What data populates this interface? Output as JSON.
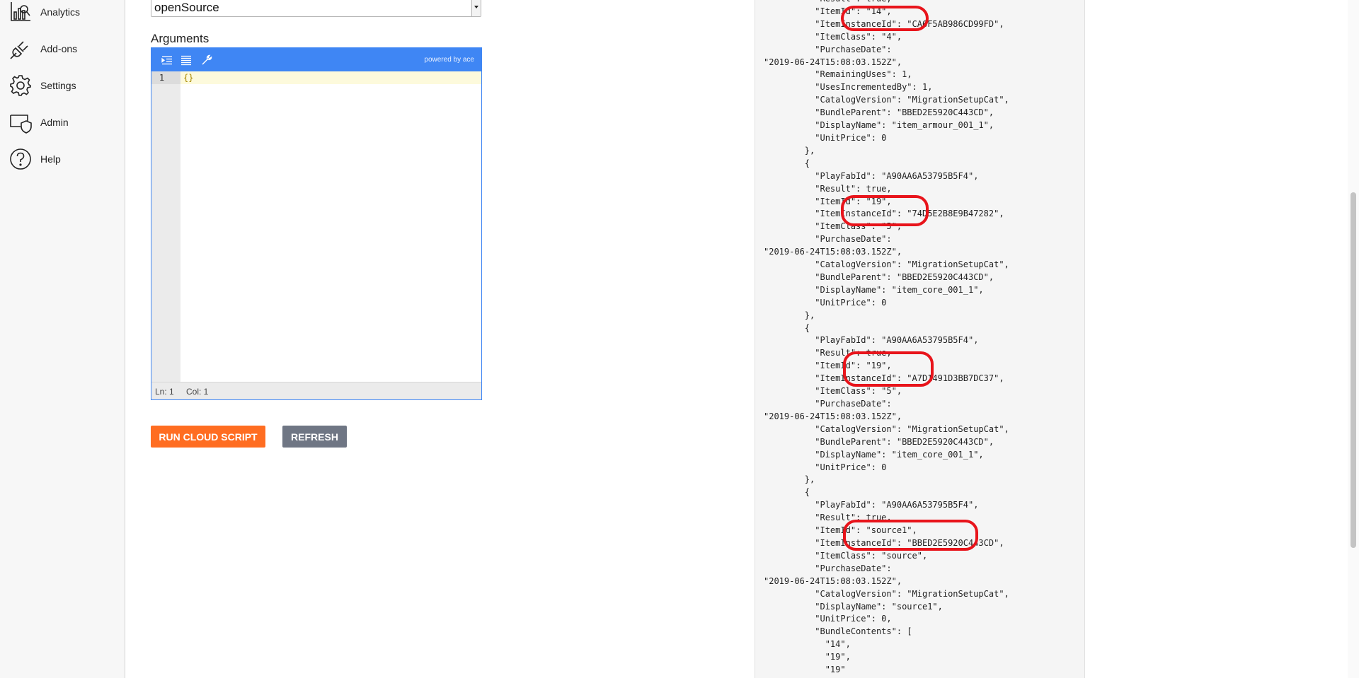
{
  "sidebar": {
    "items": [
      {
        "label": "Analytics",
        "icon": "analytics-icon"
      },
      {
        "label": "Add-ons",
        "icon": "plug-icon"
      },
      {
        "label": "Settings",
        "icon": "gear-icon"
      },
      {
        "label": "Admin",
        "icon": "admin-shield-icon"
      },
      {
        "label": "Help",
        "icon": "help-icon"
      }
    ]
  },
  "form": {
    "function_name": "openSource",
    "arguments_label": "Arguments"
  },
  "editor": {
    "powered_by": "powered by ace",
    "line_number": "1",
    "content": "{}",
    "status_ln": "Ln: 1",
    "status_col": "Col: 1"
  },
  "buttons": {
    "run_label": "Run Cloud Script",
    "refresh_label": "Refresh"
  },
  "result": {
    "text": "          \"Result\": true,\n          \"ItemId\": \"14\",\n          \"ItemInstanceId\": \"CA6F5AB986CD99FD\",\n          \"ItemClass\": \"4\",\n          \"PurchaseDate\":\n\"2019-06-24T15:08:03.152Z\",\n          \"RemainingUses\": 1,\n          \"UsesIncrementedBy\": 1,\n          \"CatalogVersion\": \"MigrationSetupCat\",\n          \"BundleParent\": \"BBED2E5920C443CD\",\n          \"DisplayName\": \"item_armour_001_1\",\n          \"UnitPrice\": 0\n        },\n        {\n          \"PlayFabId\": \"A90AA6A53795B5F4\",\n          \"Result\": true,\n          \"ItemId\": \"19\",\n          \"ItemInstanceId\": \"74D5E2B8E9B47282\",\n          \"ItemClass\": \"5\",\n          \"PurchaseDate\":\n\"2019-06-24T15:08:03.152Z\",\n          \"CatalogVersion\": \"MigrationSetupCat\",\n          \"BundleParent\": \"BBED2E5920C443CD\",\n          \"DisplayName\": \"item_core_001_1\",\n          \"UnitPrice\": 0\n        },\n        {\n          \"PlayFabId\": \"A90AA6A53795B5F4\",\n          \"Result\": true,\n          \"ItemId\": \"19\",\n          \"ItemInstanceId\": \"A7D1491D3BB7DC37\",\n          \"ItemClass\": \"5\",\n          \"PurchaseDate\":\n\"2019-06-24T15:08:03.152Z\",\n          \"CatalogVersion\": \"MigrationSetupCat\",\n          \"BundleParent\": \"BBED2E5920C443CD\",\n          \"DisplayName\": \"item_core_001_1\",\n          \"UnitPrice\": 0\n        },\n        {\n          \"PlayFabId\": \"A90AA6A53795B5F4\",\n          \"Result\": true,\n          \"ItemId\": \"source1\",\n          \"ItemInstanceId\": \"BBED2E5920C443CD\",\n          \"ItemClass\": \"source\",\n          \"PurchaseDate\":\n\"2019-06-24T15:08:03.152Z\",\n          \"CatalogVersion\": \"MigrationSetupCat\",\n          \"DisplayName\": \"source1\",\n          \"UnitPrice\": 0,\n          \"BundleContents\": [\n            \"14\",\n            \"19\",\n            \"19\""
  },
  "colors": {
    "run_button": "#ff6d21",
    "refresh_button": "#6f7684",
    "editor_accent": "#3f86f4",
    "highlight_ring": "#e8141b"
  }
}
